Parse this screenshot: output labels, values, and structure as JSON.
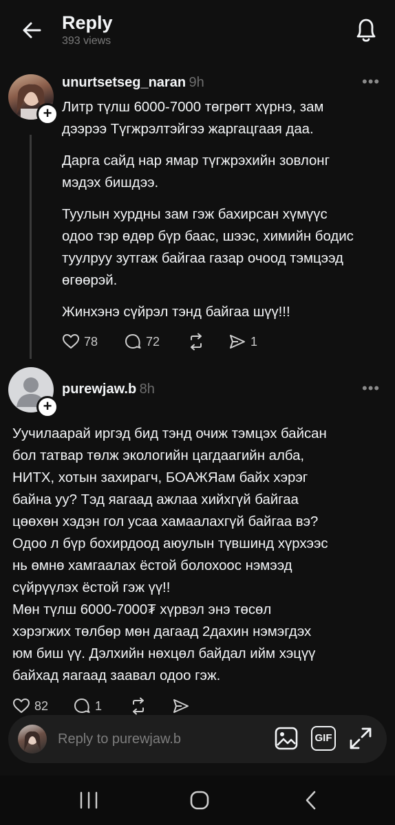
{
  "header": {
    "title": "Reply",
    "views": "393 views"
  },
  "post1": {
    "username": "unurtsetseg_naran",
    "time": "9h",
    "paragraphs": [
      "Литр түлш 6000-7000 төгрөгт хүрнэ, зам",
      "дээрээ Түгжрэлтэйгээ жаргацгаая даа.",
      "Дарга сайд нар ямар түгжрэхийн зовлонг",
      "мэдэх бишдээ.",
      "Туулын хурдны зам  гэж бахирсан хүмүүс",
      "одоо тэр өдөр бүр баас, шээс, химийн бодис",
      "туулруу зутгаж байгаа газар очоод тэмцээд",
      "өгөөрэй.",
      "Жинхэнэ сүйрэл тэнд байгаа шүү!!!"
    ],
    "likes": "78",
    "comments": "72",
    "shares": "1"
  },
  "post2": {
    "username": "purewjaw.b",
    "time": "8h",
    "lines": [
      "Уучилаарай иргэд бид тэнд очиж тэмцэх байсан",
      "бол татвар төлж экологийн цагдаагийн алба,",
      "НИТХ, хотын захирагч, БОАЖЯам байх хэрэг",
      "байна уу? Тэд яагаад ажлаа хийхгүй байгаа",
      "цөөхөн хэдэн гол усаа хамаалахгүй байгаа вэ?",
      "Одоо л бүр бохирдоод аюулын түвшинд хүрхээс",
      "нь өмнө хамгаалах ёстой болохоос нэмээд",
      "сүйрүүлэх ёстой гэж үү!!",
      "Мөн түлш 6000-7000₮ хүрвэл энэ төсөл",
      "хэрэгжих төлбөр мөн дагаад 2дахин нэмэгдэх",
      "юм биш үү. Дэлхийн нөхцөл байдал ийм хэцүү",
      "байхад яагаад заавал одоо гэж."
    ],
    "likes": "82",
    "comments": "1"
  },
  "reply_bar": {
    "placeholder": "Reply to purewjaw.b",
    "gif_label": "GIF"
  },
  "colors": {
    "background": "#101010",
    "text": "#f3f5f7",
    "muted": "#6e6e6e"
  },
  "icons": [
    "back-arrow-icon",
    "bell-icon",
    "more-icon",
    "heart-icon",
    "comment-icon",
    "repost-icon",
    "share-icon",
    "image-icon",
    "gif-icon",
    "expand-icon",
    "recents-icon",
    "home-icon",
    "nav-back-icon"
  ]
}
